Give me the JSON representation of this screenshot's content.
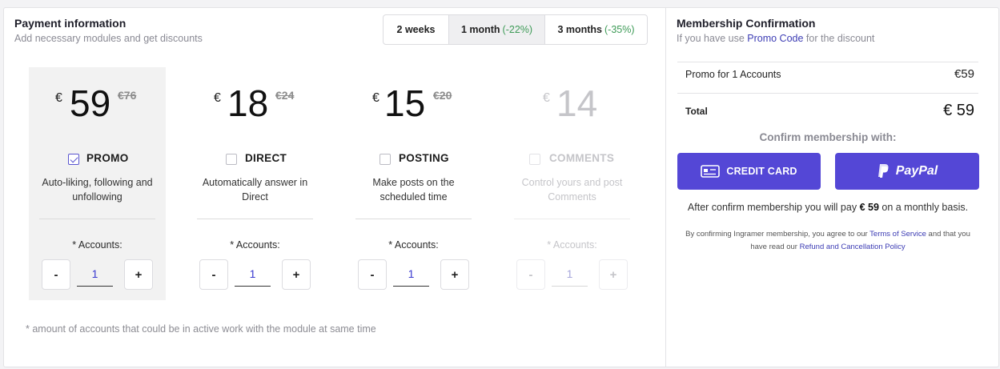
{
  "payment": {
    "title": "Payment information",
    "subtitle": "Add necessary modules and get discounts",
    "periods": [
      {
        "label": "2 weeks",
        "discount": ""
      },
      {
        "label": "1 month",
        "discount": "(-22%)"
      },
      {
        "label": "3 months",
        "discount": "(-35%)"
      }
    ],
    "selected_period": "1 month",
    "modules": [
      {
        "currency": "€",
        "price": "59",
        "old_price": "€76",
        "name": "PROMO",
        "description": "Auto-liking, following and unfollowing",
        "accounts_label": "* Accounts:",
        "quantity": "1",
        "checked": true,
        "selected": true,
        "disabled": false
      },
      {
        "currency": "€",
        "price": "18",
        "old_price": "€24",
        "name": "DIRECT",
        "description": "Automatically answer in Direct",
        "accounts_label": "* Accounts:",
        "quantity": "1",
        "checked": false,
        "selected": false,
        "disabled": false
      },
      {
        "currency": "€",
        "price": "15",
        "old_price": "€20",
        "name": "POSTING",
        "description": "Make posts on the scheduled time",
        "accounts_label": "* Accounts:",
        "quantity": "1",
        "checked": false,
        "selected": false,
        "disabled": false
      },
      {
        "currency": "€",
        "price": "14",
        "old_price": "",
        "name": "COMMENTS",
        "description": "Control yours and post Comments",
        "accounts_label": "* Accounts:",
        "quantity": "1",
        "checked": false,
        "selected": false,
        "disabled": true
      }
    ],
    "stepper": {
      "minus": "-",
      "plus": "+"
    },
    "footnote": "* amount of accounts that could be in active work with the module at same time"
  },
  "confirmation": {
    "title": "Membership Confirmation",
    "subtitle_prefix": "If you have use ",
    "promo_code_link": "Promo Code",
    "subtitle_suffix": " for the discount",
    "line_item_label": "Promo for 1 Accounts",
    "line_item_value": "€59",
    "total_label": "Total",
    "total_value": "€ 59",
    "confirm_with": "Confirm membership with:",
    "credit_card_label": "CREDIT CARD",
    "paypal_label": "PayPal",
    "after_prefix": "After confirm membership you will pay ",
    "after_amount": "€ 59",
    "after_suffix": " on a monthly basis.",
    "legal_prefix": "By confirming Ingramer membership, you agree to our ",
    "terms_link": "Terms of Service",
    "legal_middle": " and that you have read our ",
    "refund_link": "Refund and Cancellation Policy",
    "accent_color": "#5447d6",
    "discount_color": "#3e9b57"
  }
}
